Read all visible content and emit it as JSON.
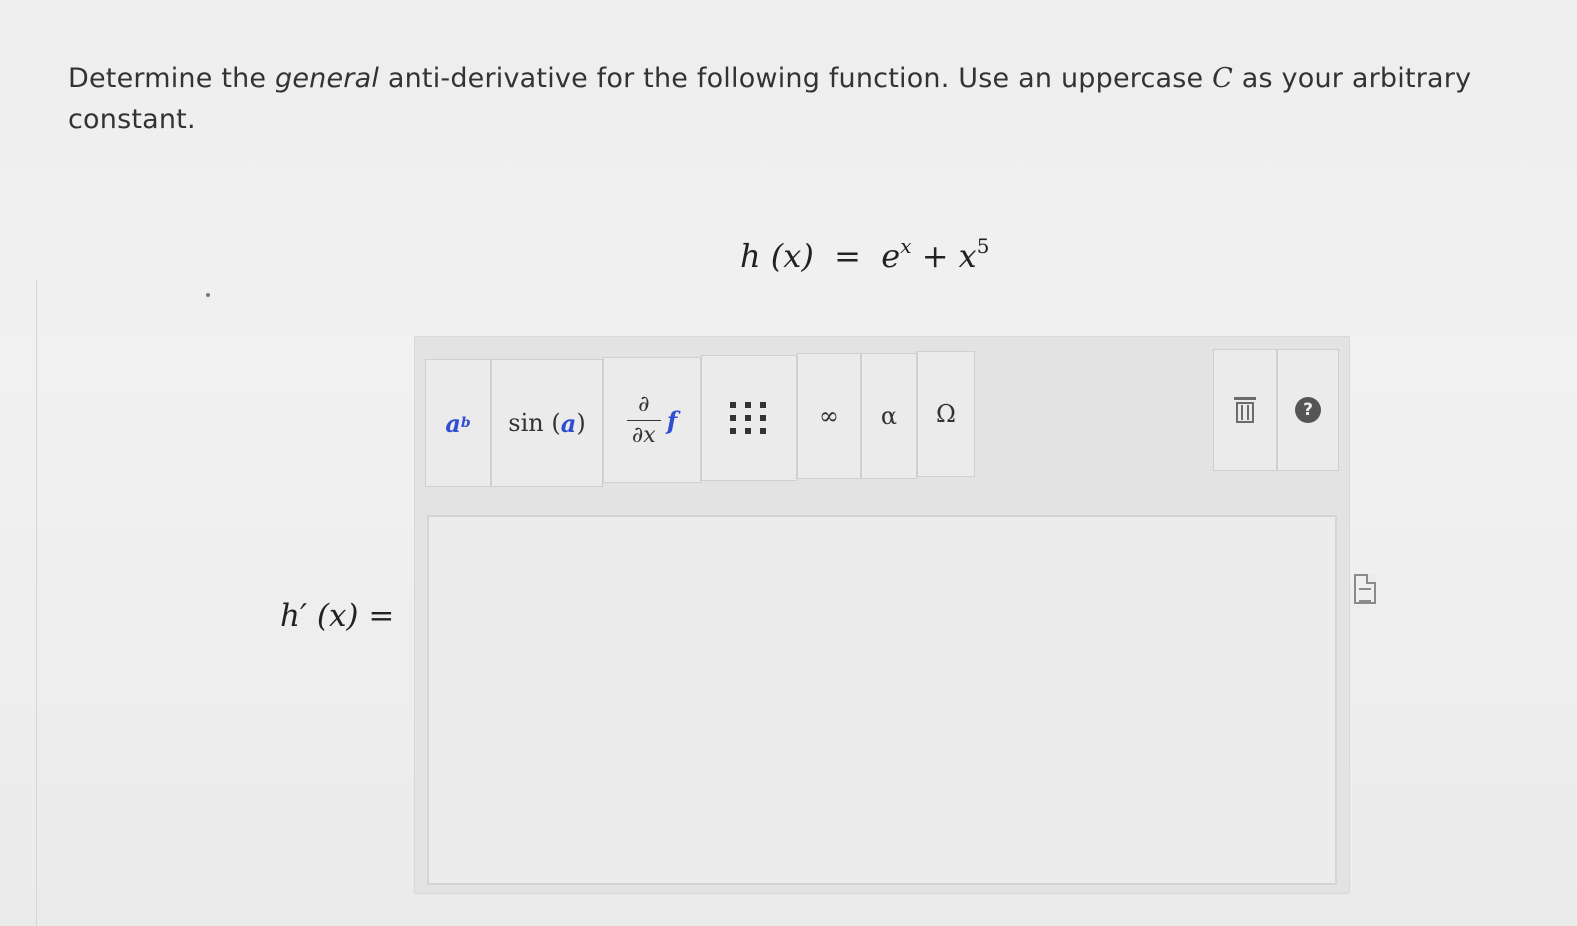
{
  "question": {
    "part1": "Determine the ",
    "emph": "general",
    "part2": " anti-derivative for the following function. Use an uppercase ",
    "var": "C",
    "part3": " as your arbitrary constant."
  },
  "given_function": {
    "lhs": "h (x)",
    "equals": "=",
    "base_e": "e",
    "exp_e": "x",
    "plus": "+",
    "base_x": "x",
    "exp_x": "5"
  },
  "answer": {
    "label": "h′ (x) ="
  },
  "toolbar": {
    "power": {
      "base": "a",
      "exp": "b"
    },
    "sin": {
      "fn": "sin",
      "open": "(",
      "arg": "a",
      "close": ")"
    },
    "derivative": {
      "num": "∂",
      "den": "∂x",
      "f": "f"
    },
    "infinity": "∞",
    "alpha": "α",
    "omega": "Ω",
    "help": "?"
  },
  "icons": {
    "matrix": "matrix-grid-icon",
    "trash": "trash-icon",
    "help": "help-icon",
    "document": "document-icon"
  }
}
